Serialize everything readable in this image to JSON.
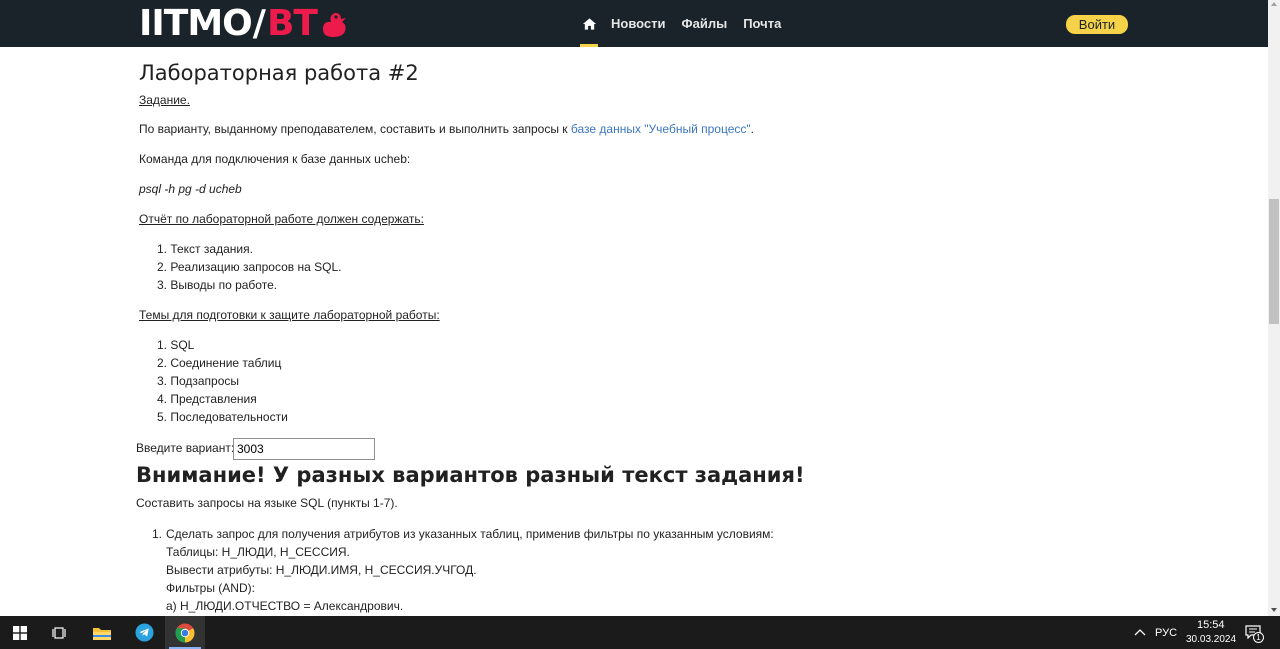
{
  "header": {
    "logo_itmo": "IITMO",
    "logo_slash": "/",
    "logo_vt": "BT",
    "nav": [
      {
        "label": "Новости"
      },
      {
        "label": "Файлы"
      },
      {
        "label": "Почта"
      }
    ],
    "login_label": "Войти",
    "accent_color": "#f5d247",
    "brand_red": "#ec1b4b"
  },
  "main": {
    "title": "Лабораторная работа #2",
    "task_heading": "Задание.",
    "intro_before_link": "По варианту, выданному преподавателем, составить и выполнить запросы к ",
    "intro_link": "базе данных \"Учебный процесс\"",
    "intro_after_link": ".",
    "connect_text": "Команда для подключения к базе данных ucheb:",
    "connect_command": "psql -h pg -d ucheb",
    "report_heading": "Отчёт по лабораторной работе должен содержать:",
    "report_items": [
      "1. Текст задания.",
      "2. Реализацию запросов на SQL.",
      "3. Выводы по работе."
    ],
    "topics_heading": "Темы для подготовки к защите лабораторной работы:",
    "topics_items": [
      "1. SQL",
      "2. Соединение таблиц",
      "3. Подзапросы",
      "4. Представления",
      "5. Последовательности"
    ],
    "variant_label": "Введите вариант:",
    "variant_value": "3003",
    "warning": "Внимание! У разных вариантов разный текст задания!",
    "compose_text": "Составить запросы на языке SQL (пункты 1-7).",
    "task1": {
      "number": "1.",
      "line1": "Сделать запрос для получения атрибутов из указанных таблиц, применив фильтры по указанным условиям:",
      "line2": "Таблицы: Н_ЛЮДИ, Н_СЕССИЯ.",
      "line3": "Вывести атрибуты: Н_ЛЮДИ.ИМЯ, Н_СЕССИЯ.УЧГОД.",
      "line4": "Фильтры (AND):",
      "line5": "a) Н_ЛЮДИ.ОТЧЕСТВО = Александрович."
    }
  },
  "taskbar": {
    "icons": [
      "windows-start-icon",
      "task-view-icon",
      "file-explorer-icon",
      "telegram-icon",
      "chrome-icon"
    ],
    "lang": "РУС",
    "time": "15:54",
    "date": "30.03.2024",
    "notification_count": "1"
  }
}
